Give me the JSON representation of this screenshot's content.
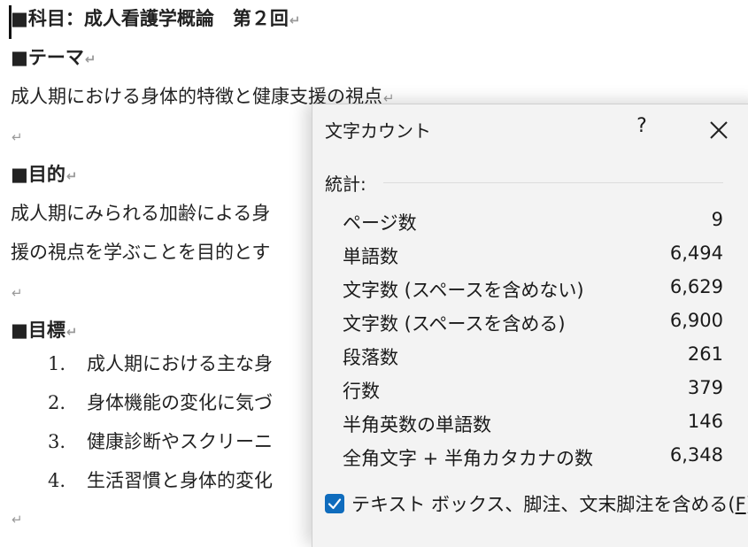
{
  "document": {
    "line1": "■科目：成人看護学概論　第２回",
    "line2": "■テーマ",
    "line3": "成人期における身体的特徴と健康支援の視点",
    "line5": "■目的",
    "line6": "成人期にみられる加齢による身",
    "line7": "援の視点を学ぶことを目的とす",
    "line9": "■目標",
    "list": [
      {
        "num": "1.",
        "text": "成人期における主な身"
      },
      {
        "num": "2.",
        "text": "身体機能の変化に気づ"
      },
      {
        "num": "3.",
        "text": "健康診断やスクリーニ"
      },
      {
        "num": "4.",
        "text": "生活習慣と身体的変化"
      }
    ],
    "paragraph_mark": "↵"
  },
  "dialog": {
    "title": "文字カウント",
    "help": "?",
    "section_label": "統計:",
    "stats": [
      {
        "label": "ページ数",
        "value": "9"
      },
      {
        "label": "単語数",
        "value": "6,494"
      },
      {
        "label": "文字数 (スペースを含めない)",
        "value": "6,629"
      },
      {
        "label": "文字数 (スペースを含める)",
        "value": "6,900"
      },
      {
        "label": "段落数",
        "value": "261"
      },
      {
        "label": "行数",
        "value": "379"
      },
      {
        "label": "半角英数の単語数",
        "value": "146"
      },
      {
        "label": "全角文字 + 半角カタカナの数",
        "value": "6,348"
      }
    ],
    "checkbox_label": "テキスト ボックス、脚注、文末脚注を含める(",
    "checkbox_access_key": "F",
    "checkbox_label_end": ")",
    "checkbox_checked": true,
    "accent_color": "#0f6cbd"
  }
}
